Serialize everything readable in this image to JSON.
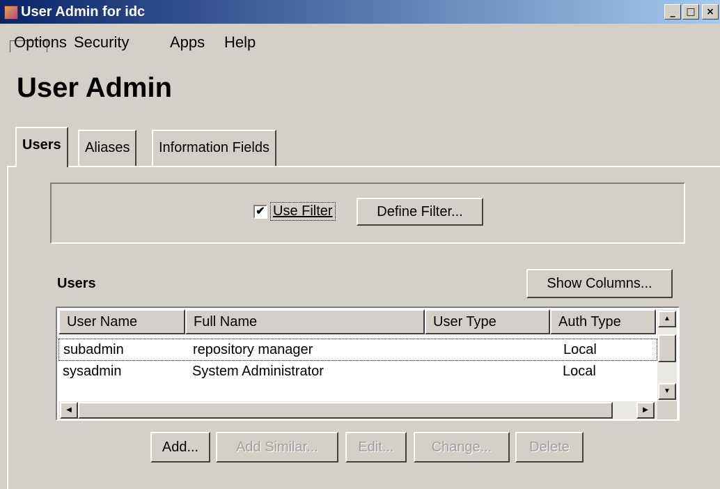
{
  "window": {
    "title": "User Admin for idc",
    "controls": {
      "minimize": "_",
      "maximize": "□",
      "close": "×"
    }
  },
  "menu": {
    "options": "Options",
    "security": "Security",
    "apps": "Apps",
    "help": "Help"
  },
  "page_title": "User Admin",
  "tabs": [
    {
      "label": "Users",
      "active": true
    },
    {
      "label": "Aliases"
    },
    {
      "label": "Information Fields"
    }
  ],
  "filter": {
    "use_filter_label": "Use Filter",
    "checked": true,
    "check_glyph": "✔",
    "define_filter": "Define Filter..."
  },
  "users_section": {
    "label": "Users",
    "show_columns": "Show Columns..."
  },
  "table": {
    "columns": [
      "User Name",
      "Full Name",
      "User Type",
      "Auth Type"
    ],
    "rows": [
      {
        "user_name": "subadmin",
        "full_name": "repository manager",
        "user_type": "",
        "auth_type": "Local"
      },
      {
        "user_name": "sysadmin",
        "full_name": "System Administrator",
        "user_type": "",
        "auth_type": "Local"
      }
    ]
  },
  "scroll_glyphs": {
    "up": "▲",
    "down": "▼",
    "left": "◀",
    "right": "▶"
  },
  "actions": {
    "add": "Add...",
    "add_similar": "Add Similar...",
    "edit": "Edit...",
    "change": "Change...",
    "delete": "Delete"
  }
}
